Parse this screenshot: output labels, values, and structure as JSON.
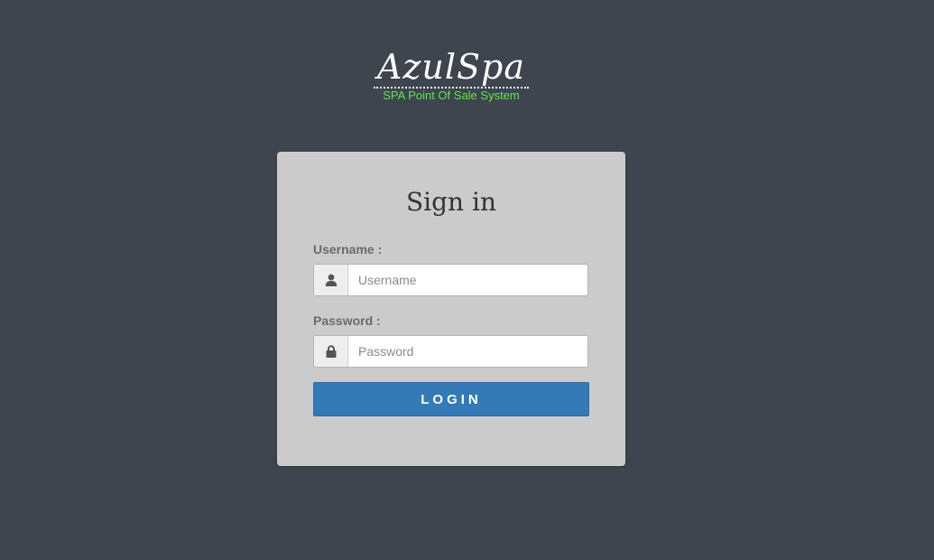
{
  "brand": {
    "title": "AzulSpa",
    "subtitle": "SPA Point Of Sale System",
    "subtitle_color": "#5ee84a"
  },
  "login": {
    "heading": "Sign in",
    "username": {
      "label": "Username :",
      "placeholder": "Username",
      "value": "",
      "icon": "user-icon"
    },
    "password": {
      "label": "Password :",
      "placeholder": "Password",
      "value": "",
      "icon": "lock-icon"
    },
    "button_label": "LOGIN",
    "button_color": "#337ab7"
  },
  "colors": {
    "background": "#3e454e",
    "card": "#cbcbcb"
  }
}
